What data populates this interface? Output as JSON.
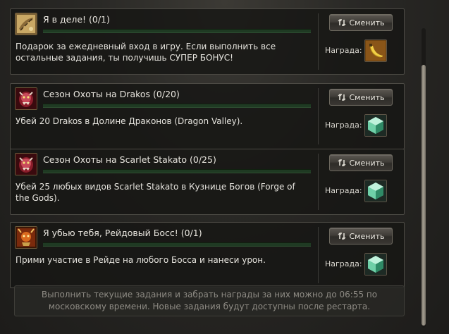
{
  "quests": [
    {
      "title": "Я в деле! (0/1)",
      "progress": 0,
      "description": "Подарок за ежедневный вход в игру. Если выполнить все остальные задания, ты получишь СУПЕР БОНУС!",
      "change_label": "Сменить",
      "reward_label": "Награда:",
      "icon": "scroll-icon",
      "reward_icon": "banana-icon"
    },
    {
      "title": "Сезон Охоты на Drakos (0/20)",
      "progress": 0,
      "description": "Убей 20 Drakos в Долине Драконов (Dragon Valley).",
      "change_label": "Сменить",
      "reward_label": "Награда:",
      "icon": "monster-icon",
      "reward_icon": "green-gem-icon"
    },
    {
      "title": "Сезон Охоты на Scarlet Stakato (0/25)",
      "progress": 0,
      "description": "Убей 25 любых видов Scarlet Stakato в Кузнице Богов (Forge of the Gods).",
      "change_label": "Сменить",
      "reward_label": "Награда:",
      "icon": "monster-icon",
      "reward_icon": "green-gem-icon"
    },
    {
      "title": "Я убью тебя, Рейдовый Босс! (0/1)",
      "progress": 0,
      "description": "Прими участие в Рейде на любого Босса и нанеси урон.",
      "change_label": "Сменить",
      "reward_label": "Награда:",
      "icon": "raid-boss-icon",
      "reward_icon": "green-gem-icon"
    }
  ],
  "footer": {
    "text": "Выполнить текущие задания и забрать награды за них можно до 06:55 по московскому времени. Новые задания будут доступны после рестарта."
  },
  "colors": {
    "progress_track": "#1f3a23",
    "progress_fill": "#58a84a",
    "panel_border": "#4c4a44",
    "footer_text": "#8e8b84"
  }
}
